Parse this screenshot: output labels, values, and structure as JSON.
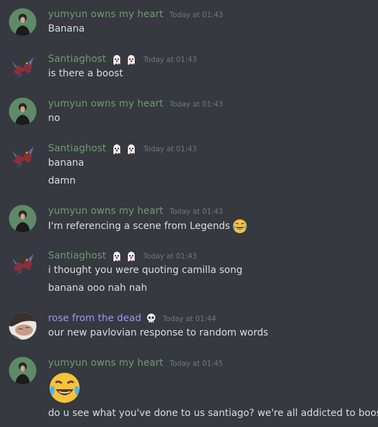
{
  "colors": {
    "background": "#36393f",
    "message_text": "#dcddde",
    "timestamp": "#72767d",
    "user_green": "#6b9b72",
    "user_purple": "#a390ff"
  },
  "messages": [
    {
      "username": "yumyun owns my heart",
      "timestamp": "Today at 01:43",
      "avatar_icon": "portrait-avatar",
      "lines": [
        "Banana"
      ]
    },
    {
      "username": "Santiaghost",
      "badges": [
        "ghost-emoji",
        "ghost-emoji"
      ],
      "timestamp": "Today at 01:43",
      "avatar_icon": "dragon-avatar",
      "lines": [
        "is there a boost"
      ]
    },
    {
      "username": "yumyun owns my heart",
      "timestamp": "Today at 01:43",
      "avatar_icon": "portrait-avatar",
      "lines": [
        "no"
      ]
    },
    {
      "username": "Santiaghost",
      "badges": [
        "ghost-emoji",
        "ghost-emoji"
      ],
      "timestamp": "Today at 01:43",
      "avatar_icon": "dragon-avatar",
      "lines": [
        "banana",
        "damn"
      ]
    },
    {
      "username": "yumyun owns my heart",
      "timestamp": "Today at 01:43",
      "avatar_icon": "portrait-avatar",
      "lines": [
        "I'm referencing a scene from Legends"
      ],
      "inline_emoji": "laughing-tears-emoji"
    },
    {
      "username": "Santiaghost",
      "badges": [
        "ghost-emoji",
        "ghost-emoji"
      ],
      "timestamp": "Today at 01:43",
      "avatar_icon": "dragon-avatar",
      "lines": [
        "i thought you were quoting camilla song",
        "banana ooo nah nah"
      ]
    },
    {
      "username": "rose from the dead",
      "badges": [
        "skull-emoji"
      ],
      "timestamp": "Today at 01:44",
      "avatar_icon": "sleeping-face-avatar",
      "lines": [
        "our new pavlovian response to random words"
      ]
    },
    {
      "username": "yumyun owns my heart",
      "timestamp": "Today at 01:45",
      "avatar_icon": "portrait-avatar",
      "big_emoji": "laughing-tears-emoji",
      "lines": [
        "do u see what you've done to us santiago? we're all addicted to boosts."
      ]
    }
  ]
}
